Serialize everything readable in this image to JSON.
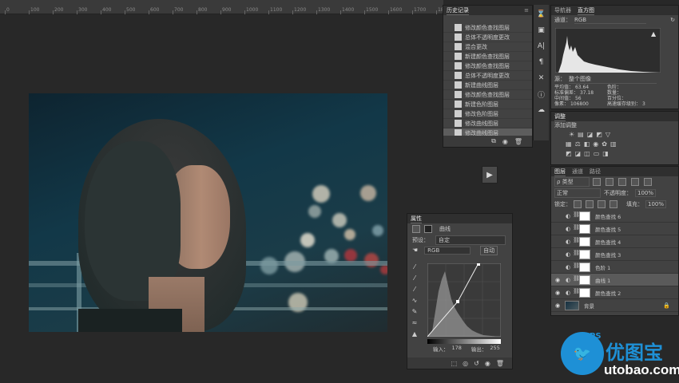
{
  "ruler": {
    "ticks": [
      "0",
      "100",
      "200",
      "300",
      "400",
      "500",
      "600",
      "700",
      "800",
      "900",
      "1000",
      "1100",
      "1200",
      "1300",
      "1400",
      "1500",
      "1600",
      "1700",
      "18"
    ]
  },
  "history": {
    "title": "历史记录",
    "items": [
      "修改颜色查找图层",
      "总体不透明度更改",
      "混合更改",
      "新建颜色查找图层",
      "修改颜色查找图层",
      "总体不透明度更改",
      "新建曲线图层",
      "修改颜色查找图层",
      "新建色阶图层",
      "修改色阶图层",
      "修改曲线图层",
      "修改曲线图层"
    ],
    "selected_index": 11
  },
  "properties": {
    "title": "属性",
    "subtitle": "曲线",
    "preset_label": "预设：",
    "preset_value": "自定",
    "channel_value": "RGB",
    "auto_label": "自动",
    "input_label": "输入：",
    "input_value": "178",
    "output_label": "输出：",
    "output_value": "255"
  },
  "histogram": {
    "tab1": "导航器",
    "tab2": "直方图",
    "channel_label": "通道：",
    "channel_value": "RGB",
    "source_label": "源：",
    "source_value": "整个图像",
    "stats_left": [
      {
        "label": "平均值：",
        "value": "63.64"
      },
      {
        "label": "标准偏差：",
        "value": "37.18"
      },
      {
        "label": "中间值：",
        "value": "56"
      },
      {
        "label": "像素：",
        "value": "106800"
      }
    ],
    "stats_right": [
      {
        "label": "色阶：",
        "value": ""
      },
      {
        "label": "数量：",
        "value": ""
      },
      {
        "label": "百分位：",
        "value": ""
      },
      {
        "label": "高速缓存级别：",
        "value": "3"
      }
    ]
  },
  "adjustments": {
    "title": "调整",
    "subtitle": "添加调整"
  },
  "layers": {
    "tab1": "图层",
    "tab2": "通道",
    "tab3": "路径",
    "kind_label": "ρ 类型",
    "blend_mode": "正常",
    "opacity_label": "不透明度：",
    "opacity_value": "100%",
    "lock_label": "锁定：",
    "fill_label": "填充：",
    "fill_value": "100%",
    "items": [
      {
        "name": "颜色查找 6",
        "visible": false
      },
      {
        "name": "颜色查找 5",
        "visible": false
      },
      {
        "name": "颜色查找 4",
        "visible": false
      },
      {
        "name": "颜色查找 3",
        "visible": false
      },
      {
        "name": "色阶 1",
        "visible": false
      },
      {
        "name": "曲线 1",
        "visible": true
      },
      {
        "name": "颜色查找 2",
        "visible": true
      },
      {
        "name": "背景",
        "visible": true
      }
    ],
    "selected_index": 5
  },
  "watermark": {
    "text": "优图宝",
    "url": "utobao.com",
    "badge": "PS"
  },
  "colors": {
    "bg": "#282828",
    "panel": "#424242",
    "accent": "#1e90d6"
  }
}
